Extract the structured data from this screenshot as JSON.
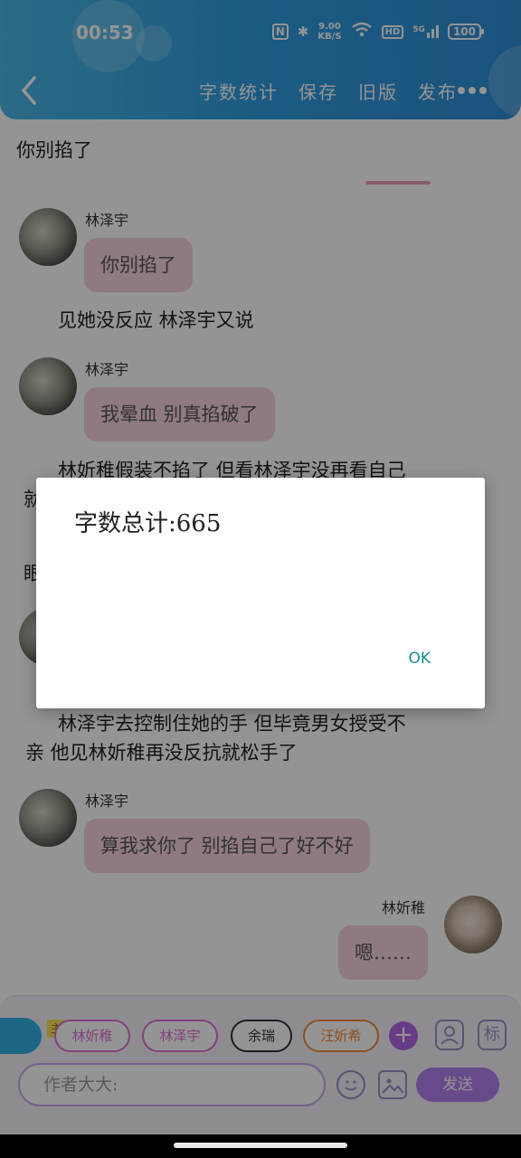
{
  "status": {
    "time": "00:53",
    "net_speed_top": "9.00",
    "net_speed_bottom": "KB/S",
    "hd": "HD",
    "signal": "5G",
    "battery": "100"
  },
  "header": {
    "toolbar": [
      "字数统计",
      "保存",
      "旧版",
      "发布"
    ]
  },
  "chat": {
    "top_text": "你别掐了",
    "messages": [
      {
        "type": "bubble",
        "speaker": "林泽宇",
        "text": "你别掐了"
      },
      {
        "type": "narration",
        "text": "见她没反应 林泽宇又说"
      },
      {
        "type": "bubble",
        "speaker": "林泽宇",
        "text": "我晕血 别真掐破了"
      },
      {
        "type": "narration",
        "text": "林妡稚假装不掐了 但看林泽宇没再看自己"
      },
      {
        "type": "narration_partial_1",
        "text": "就"
      },
      {
        "type": "narration_partial_2",
        "text": "眼"
      },
      {
        "type": "narration",
        "text": "林泽宇去控制住她的手 但毕竟男女授受不"
      },
      {
        "type": "narration",
        "text": "亲 他见林妡稚再没反抗就松手了"
      },
      {
        "type": "bubble",
        "speaker": "林泽宇",
        "text": "算我求你了 别掐自己了好不好"
      },
      {
        "type": "bubble_right",
        "speaker": "林妡稚",
        "text": "嗯……"
      }
    ]
  },
  "bottom": {
    "main_tag": "主",
    "characters": [
      "林妡稚",
      "林泽宇",
      "余瑞",
      "汪妡希"
    ],
    "char_colors": [
      "#e070d8",
      "#e070d8",
      "#333333",
      "#f08a3c"
    ],
    "add": "+",
    "mark": "标",
    "input_placeholder": "作者大大:",
    "send": "发送"
  },
  "dialog": {
    "title": "字数总计:665",
    "ok": "OK"
  }
}
